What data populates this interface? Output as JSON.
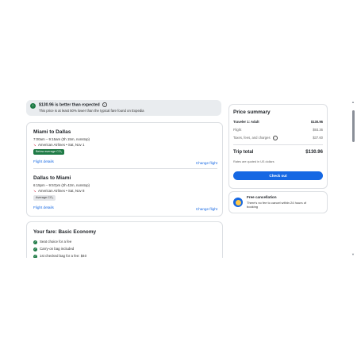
{
  "banner": {
    "title": "$130.96 is better than expected",
    "info_glyph": "i",
    "subtitle": "This price is at least 50% lower than the typical fare found on Expedia",
    "icon": "arrow-down-icon"
  },
  "flights": [
    {
      "route": "Miami to Dallas",
      "times": "7:00am – 9:15am (3h 15m, nonstop)",
      "airline": "American Airlines • Sat, Nov 1",
      "co2_badge": "Below average CO₂",
      "details_link": "Flight details",
      "change_link": "Change flight"
    },
    {
      "route": "Dallas to Miami",
      "times": "6:15pm – 9:57pm (2h 42m, nonstop)",
      "airline": "American Airlines • Sat, Nov 8",
      "co2_badge": "Average CO₂",
      "details_link": "Flight details",
      "change_link": "Change flight"
    }
  ],
  "fare": {
    "title": "Your fare: Basic Economy",
    "items": [
      "Seat choice for a fee",
      "Carry-on bag included",
      "1st checked bag for a fee: $40"
    ]
  },
  "summary": {
    "title": "Price summary",
    "traveler_label": "Traveler 1: Adult",
    "traveler_value": "$130.96",
    "flight_label": "Flight",
    "flight_value": "$93.36",
    "taxes_label": "Taxes, fees, and charges",
    "taxes_value": "$37.60",
    "total_label": "Trip total",
    "total_value": "$130.96",
    "quoted_note": "Rates are quoted in US dollars",
    "checkout_label": "Check out"
  },
  "cancellation": {
    "title": "Free cancellation",
    "subtitle": "There's no fee to cancel within 24 hours of booking"
  },
  "colors": {
    "accent": "#1668e3",
    "success": "#1e7a45",
    "banner_bg": "#e9ecef"
  }
}
